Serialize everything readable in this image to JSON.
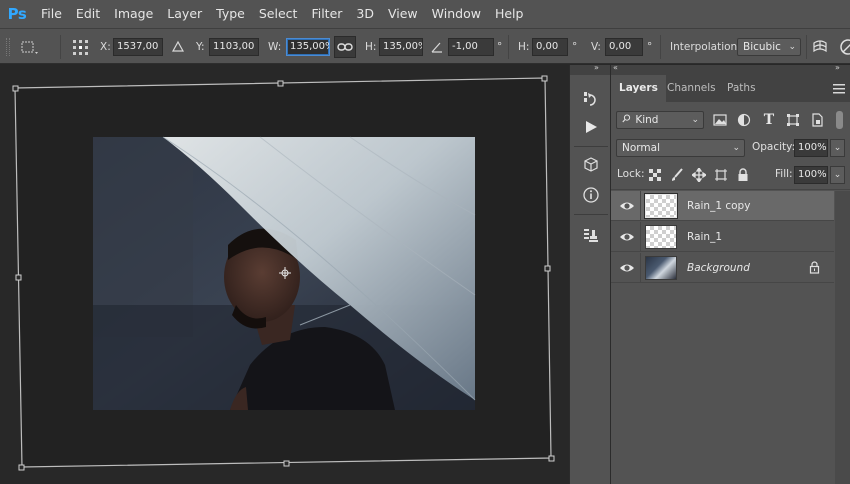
{
  "app": {
    "logo": "Ps"
  },
  "menu": [
    "File",
    "Edit",
    "Image",
    "Layer",
    "Type",
    "Select",
    "Filter",
    "3D",
    "View",
    "Window",
    "Help"
  ],
  "options": {
    "x_label": "X:",
    "x_value": "1537,00 px",
    "y_label": "Y:",
    "y_value": "1103,00 px",
    "w_label": "W:",
    "w_value": "135,00%",
    "h_label": "H:",
    "h_value": "135,00%",
    "angle_value": "-1,00",
    "angle_unit": "°",
    "skew_h_label": "H:",
    "skew_h_value": "0,00",
    "skew_h_unit": "°",
    "skew_v_label": "V:",
    "skew_v_value": "0,00",
    "skew_v_unit": "°",
    "interp_label": "Interpolation:",
    "interp_value": "Bicubic"
  },
  "panel": {
    "tabs": [
      "Layers",
      "Channels",
      "Paths"
    ],
    "filter_kind": "Kind",
    "blend_mode": "Normal",
    "opacity_label": "Opacity:",
    "opacity_value": "100%",
    "lock_label": "Lock:",
    "fill_label": "Fill:",
    "fill_value": "100%",
    "layers": [
      {
        "name": "Rain_1 copy",
        "selected": true
      },
      {
        "name": "Rain_1",
        "selected": false
      },
      {
        "name": "Background",
        "selected": false,
        "locked": true
      }
    ]
  },
  "colors": {
    "chrome": "#535353",
    "canvas_bg": "#282828",
    "ps_blue": "#31a8ff",
    "selection_highlight": "#696969"
  }
}
